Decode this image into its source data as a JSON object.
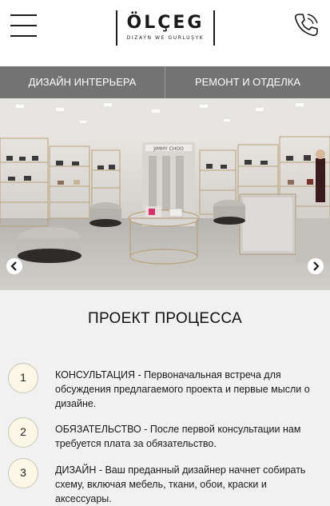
{
  "header": {
    "logo_main": "ÖLÇEG",
    "logo_sub": "DIZAÝN WE GURLUŞYK",
    "menu_icon": "hamburger-menu-icon",
    "phone_icon": "phone-icon"
  },
  "nav": {
    "items": [
      {
        "label": "ДИЗАЙН ИНТЕРЬЕРА"
      },
      {
        "label": "РЕМОНТ И ОТДЕЛКА"
      }
    ]
  },
  "slider": {
    "prev_icon": "chevron-left-icon",
    "next_icon": "chevron-right-icon",
    "store_sign": "JIMMY CHOO"
  },
  "section": {
    "title": "ПРОЕКТ ПРОЦЕССА"
  },
  "steps": [
    {
      "number": "1",
      "text": "КОНСУЛЬТАЦИЯ - Первоначальная встреча для обсуждения предлагаемого проекта и первые мысли о дизайне."
    },
    {
      "number": "2",
      "text": "ОБЯЗАТЕЛЬСТВО - После первой консультации нам требуется плата за обязательство."
    },
    {
      "number": "3",
      "text": "ДИЗАЙН - Ваш преданный дизайнер начнет собирать схему, включая мебель, ткани, обои, краски и аксессуары."
    }
  ],
  "colors": {
    "nav_bg": "#737373",
    "page_bg": "#f1f1f1",
    "step_circle_bg": "#fbf7e6"
  }
}
